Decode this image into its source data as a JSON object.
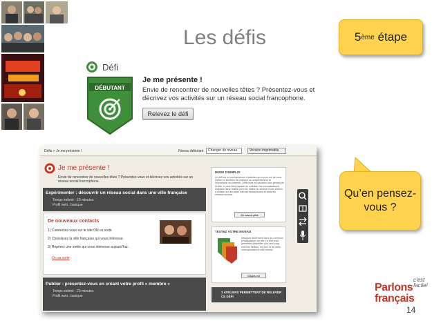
{
  "slide": {
    "title": "Les défis",
    "step_number": "5",
    "step_sup": "ème",
    "step_word": "étape",
    "question": "Qu’en pensez-vous ?",
    "page_number": "14"
  },
  "logo": {
    "line1": "Parlons",
    "line2": "français",
    "tag": "c'est facile!"
  },
  "defi_card": {
    "header": "Défi",
    "badge": "DÉBUTANT",
    "title": "Je me présente !",
    "description": "Envie de rencontrer de nouvelles têtes ? Présentez-vous et décrivez vos activités sur un réseau social francophone.",
    "button": "Relevez le défi"
  },
  "screenshot": {
    "breadcrumb": "Défis > Je me présente !",
    "level_label": "Niveau débutant",
    "level_select": "Changer de niveau",
    "version_btn": "Version imprimable",
    "title": "Je me présente !",
    "intro": "Envie de rencontrer de nouvelles têtes ? Présentez-vous et décrivez vos activités sur un réseau social francophone.",
    "exp_title": "Expérimenter : découvrir un réseau social dans une ville française",
    "exp_time": "Temps estimé : 10 minutes",
    "exp_profile": "Profil web : basique",
    "contacts_title": "De nouveaux contacts",
    "steps": [
      "1) Connectez-vous sur le site ON va sortir.",
      "2) Choisissez la ville française qui vous intéresse.",
      "3) Repérez une sortie qui vous intéresse aujourd'hui."
    ],
    "link": "On va sortir",
    "pub_title": "Publier : présentez-vous en créant votre profil « membre »",
    "pub_time": "Temps estimé : 20 minutes",
    "pub_profile": "Profil web : basique",
    "side1_title": "MODE D'EMPLOI",
    "side1_text": "Le défi est un enchaînement d'activités qui a pour but de vous mettre en situation de pratiquer la compréhension et l'expression sur Internet. Cette mise en situation vous permet de vérifier si vous êtes capable de mobiliser les connaissances acquises dans l'atelier pour les mettre au service d'une mission à réaliser sur des sites internet francophones et dans les réseaux sociaux.",
    "side1_btn": "En savoir plus",
    "side2_title": "TESTEZ VOTRE NIVEAU",
    "side2_text": "Naviguez facilement dans les contenus pédagogiques du site. Le test vous permettra d'identifier d'un seul coup d'œil les ateliers, les jeux et les défis correspondant à votre niveau.",
    "side2_btn": "Cliquez ici",
    "side3_title": "2 ATELIERS PERMETTENT DE RELEVER CE DÉFI"
  },
  "colors": {
    "yellow": "#ffd34d",
    "green": "#3f8f3a",
    "dark": "#4a4a4a",
    "red": "#c0392b"
  }
}
